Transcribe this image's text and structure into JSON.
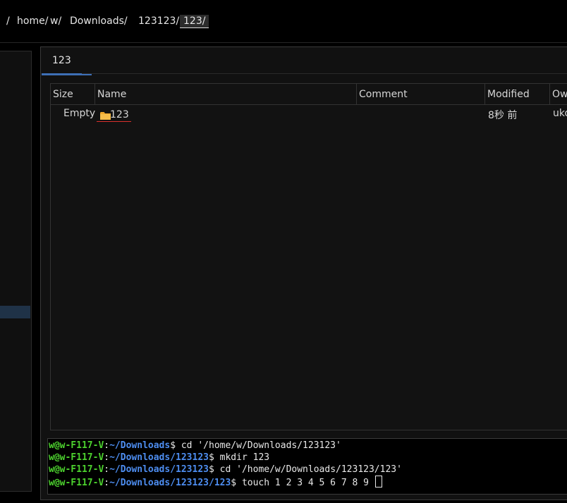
{
  "breadcrumb": {
    "items": [
      "/",
      "home/",
      "w/",
      "Downloads/",
      "123123/",
      "123/"
    ]
  },
  "tab": {
    "label": "123"
  },
  "table": {
    "columns": [
      "Size",
      "Name",
      "Comment",
      "Modified",
      "Ow"
    ],
    "rows": [
      {
        "size": "Empty",
        "name": "123",
        "comment": "",
        "modified": "8秒 前",
        "owner": "uko"
      }
    ]
  },
  "terminal": {
    "lines": [
      {
        "user": "w@w-F117-V",
        "path": "~/Downloads",
        "cmd": "cd '/home/w/Downloads/123123'"
      },
      {
        "user": "w@w-F117-V",
        "path": "~/Downloads/123123",
        "cmd": "mkdir 123"
      },
      {
        "user": "w@w-F117-V",
        "path": "~/Downloads/123123",
        "cmd": "cd '/home/w/Downloads/123123/123'"
      },
      {
        "user": "w@w-F117-V",
        "path": "~/Downloads/123123/123",
        "cmd": "touch 1 2 3 4 5 6 7 8 9 "
      }
    ]
  },
  "colors": {
    "accent": "#3d6fb6",
    "terminal_user": "#4cd12e",
    "terminal_path": "#4d8df0",
    "folder": "#f0a82c",
    "underline": "#d9302b"
  }
}
